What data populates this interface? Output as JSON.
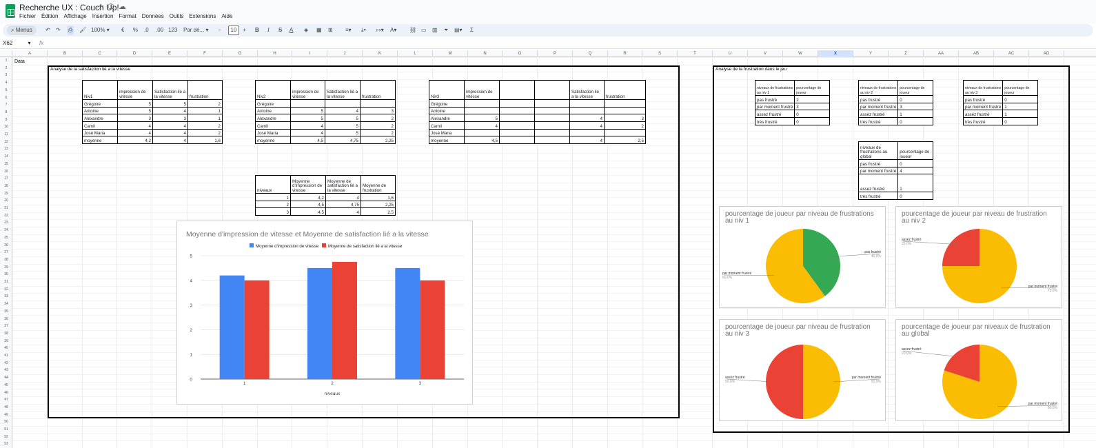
{
  "app": {
    "doc_title": "Recherche UX : Couch Up!",
    "menu": [
      "Fichier",
      "Édition",
      "Affichage",
      "Insertion",
      "Format",
      "Données",
      "Outils",
      "Extensions",
      "Aide"
    ]
  },
  "toolbar": {
    "search_label": "Menus",
    "zoom": "100%",
    "currency": "€",
    "percent": "%",
    "dec_decrease": ".0",
    "dec_increase": ".00",
    "number_format": "123",
    "font": "Par dé...",
    "font_minus": "−",
    "font_size": "10",
    "font_plus": "+",
    "bold": "B",
    "italic": "I",
    "strike": "S",
    "text_color": "A",
    "sum": "Σ"
  },
  "formula_bar": {
    "cell_ref": "X62",
    "fx": "fx"
  },
  "columns": [
    "A",
    "B",
    "C",
    "D",
    "E",
    "F",
    "G",
    "H",
    "I",
    "J",
    "K",
    "L",
    "M",
    "N",
    "O",
    "P",
    "Q",
    "R",
    "S",
    "T",
    "U",
    "V",
    "W",
    "X",
    "Y",
    "Z",
    "AA",
    "AB",
    "AC",
    "AD"
  ],
  "selected_column": "X",
  "cells": {
    "a1": "Data",
    "b2": "Analyse de la satisfaction lié a la vitesse",
    "u2": "Analyse de la frustration dans le jeu"
  },
  "niv1": {
    "headers": [
      "Niv1",
      "impression de vitesse",
      "Satisfaction lié a la vitesse",
      "frustration"
    ],
    "rows": [
      [
        "Grégoire",
        "5",
        "5",
        "2"
      ],
      [
        "Antoine",
        "5",
        "4",
        "1"
      ],
      [
        "Alexandre",
        "3",
        "3",
        "1"
      ],
      [
        "Camil",
        "4",
        "4",
        "2"
      ],
      [
        "José Maria",
        "4",
        "4",
        "2"
      ],
      [
        "moyenne",
        "4,2",
        "4",
        "1,6"
      ]
    ]
  },
  "niv2": {
    "headers": [
      "Niv2",
      "impression de vitesse",
      "Satisfaction lié a la vitesse",
      "frustration"
    ],
    "rows": [
      [
        "Grégoire",
        "",
        "",
        ""
      ],
      [
        "Antoine",
        "5",
        "4",
        "3"
      ],
      [
        "Alexandre",
        "5",
        "5",
        "2"
      ],
      [
        "Camil",
        "4",
        "5",
        "2"
      ],
      [
        "José Maria",
        "4",
        "5",
        "2"
      ],
      [
        "moyenne",
        "4,5",
        "4,75",
        "2,25"
      ]
    ]
  },
  "niv3": {
    "headers": [
      "Niv3",
      "impression de vitesse",
      "",
      "",
      "Satisfaction lié a la vitesse",
      "frustration"
    ],
    "rows": [
      [
        "Grégoire",
        "",
        "",
        "",
        "",
        ""
      ],
      [
        "Antoine",
        "",
        "",
        "",
        "",
        ""
      ],
      [
        "Alexandre",
        "5",
        "",
        "",
        "4",
        "3"
      ],
      [
        "Camil",
        "4",
        "",
        "",
        "4",
        "2"
      ],
      [
        "José Maria",
        "",
        "",
        "",
        "",
        ""
      ],
      [
        "moyenne",
        "4,5",
        "",
        "",
        "4",
        "2,5"
      ]
    ]
  },
  "summary": {
    "headers": [
      "niveaux",
      "Moyenne d'impression de vitesse",
      "Moyenne de satisfaction lié a la vitesse",
      "Moyenne de frustration"
    ],
    "rows": [
      [
        "1",
        "4,2",
        "4",
        "1,6"
      ],
      [
        "2",
        "4,5",
        "4,75",
        "2,25"
      ],
      [
        "3",
        "4,5",
        "4",
        "2,5"
      ]
    ]
  },
  "frust1": {
    "headers": [
      "niveaux de frustrations au niv 1",
      "pourcentage de joueur"
    ],
    "rows": [
      [
        "pas frustré",
        "2"
      ],
      [
        "par moment frustré",
        "3"
      ],
      [
        "assez frustré",
        "0"
      ],
      [
        "très frustré",
        "0"
      ]
    ]
  },
  "frust2": {
    "headers": [
      "niveaux de frustrations au niv 2",
      "pourcentage de joueur"
    ],
    "rows": [
      [
        "pas frustré",
        "0"
      ],
      [
        "par moment frustré",
        "3"
      ],
      [
        "assez frustré",
        "1"
      ],
      [
        "très frustré",
        "0"
      ]
    ]
  },
  "frust3": {
    "headers": [
      "niveaux de frustrations au niv 3",
      "pourcentage de joueur"
    ],
    "rows": [
      [
        "pas frustré",
        "0"
      ],
      [
        "par moment frustré",
        "1"
      ],
      [
        "assez frustré",
        "1"
      ],
      [
        "très frustré",
        "0"
      ]
    ]
  },
  "frust_global": {
    "headers": [
      "niveaux de frustrations au global",
      "pourcentage de joueur"
    ],
    "rows": [
      [
        "pas frustré",
        "0"
      ],
      [
        "par moment frustré",
        "4"
      ],
      [
        "assez frustré",
        "1"
      ],
      [
        "très frustré",
        "0"
      ]
    ]
  },
  "colors": {
    "blue": "#4285f4",
    "red": "#ea4335",
    "yellow": "#fbbc04",
    "green": "#34a853"
  },
  "chart_data": [
    {
      "type": "bar",
      "title": "Moyenne d'impression de vitesse et Moyenne de satisfaction lié a la vitesse",
      "xlabel": "niveaux",
      "ylabel": "",
      "categories": [
        "1",
        "2",
        "3"
      ],
      "ylim": [
        0,
        5
      ],
      "yticks": [
        "0",
        "1",
        "2",
        "3",
        "4",
        "5"
      ],
      "legend": "top",
      "series": [
        {
          "name": "Moyenne d'impression de vitesse",
          "values": [
            4.2,
            4.5,
            4.5
          ],
          "color": "#4285f4"
        },
        {
          "name": "Moyenne de satisfaction lié a la vitesse",
          "values": [
            4,
            4.75,
            4
          ],
          "color": "#ea4335"
        }
      ]
    },
    {
      "type": "pie",
      "title": "pourcentage de joueur par niveau de frustrations au niv 1",
      "slices": [
        {
          "label": "pas frustré",
          "value": 2,
          "pct": "40,0%",
          "color": "#34a853"
        },
        {
          "label": "par moment frustré",
          "value": 3,
          "pct": "60,0%",
          "color": "#fbbc04"
        }
      ]
    },
    {
      "type": "pie",
      "title": "pourcentage de joueur par niveau de frustration au niv 2",
      "slices": [
        {
          "label": "par moment frustré",
          "value": 3,
          "pct": "75,0%",
          "color": "#fbbc04"
        },
        {
          "label": "assez frustré",
          "value": 1,
          "pct": "25,0%",
          "color": "#ea4335"
        }
      ]
    },
    {
      "type": "pie",
      "title": "pourcentage de joueur par niveau de frustration au niv 3",
      "slices": [
        {
          "label": "par moment frustré",
          "value": 1,
          "pct": "50,0%",
          "color": "#fbbc04"
        },
        {
          "label": "assez frustré",
          "value": 1,
          "pct": "50,0%",
          "color": "#ea4335"
        }
      ]
    },
    {
      "type": "pie",
      "title": "pourcentage de joueur par niveaux de frustration au global",
      "slices": [
        {
          "label": "par moment frustré",
          "value": 4,
          "pct": "80,0%",
          "color": "#fbbc04"
        },
        {
          "label": "assez frustré",
          "value": 1,
          "pct": "20,0%",
          "color": "#ea4335"
        }
      ]
    }
  ]
}
